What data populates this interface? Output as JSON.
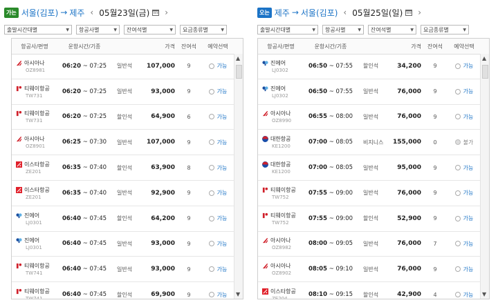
{
  "colors": {
    "accent": "#1b73c6",
    "badge_out": "#2a8a2a",
    "badge_in": "#1b73c6"
  },
  "outbound": {
    "badge": "가는",
    "from": "서울(김포)",
    "to": "제주",
    "date": "05월23일(금)",
    "filters": [
      "출발시간대별",
      "항공사별",
      "잔여석별",
      "요금종류별"
    ],
    "headers": {
      "airline": "항공사/편명",
      "time": "운항시간/기종",
      "price": "가격",
      "remaining": "잔여석",
      "reserve": "예약선택"
    },
    "flights": [
      {
        "airline": "아시아나",
        "code": "OZ8981",
        "logo": "asiana-logo-icon",
        "start": "06:20",
        "end": "07:25",
        "seat": "일반석",
        "price": "107,000",
        "remaining": "9",
        "label": "가능",
        "available": true
      },
      {
        "airline": "티웨이항공",
        "code": "TW731",
        "logo": "tway-logo-icon",
        "start": "06:20",
        "end": "07:25",
        "seat": "일반석",
        "price": "93,000",
        "remaining": "9",
        "label": "가능",
        "available": true
      },
      {
        "airline": "티웨이항공",
        "code": "TW731",
        "logo": "tway-logo-icon",
        "start": "06:20",
        "end": "07:25",
        "seat": "할인석",
        "price": "64,900",
        "remaining": "6",
        "label": "가능",
        "available": true
      },
      {
        "airline": "아시아나",
        "code": "OZ8901",
        "logo": "asiana-logo-icon",
        "start": "06:25",
        "end": "07:30",
        "seat": "일반석",
        "price": "107,000",
        "remaining": "9",
        "label": "가능",
        "available": true
      },
      {
        "airline": "이스타항공",
        "code": "ZE201",
        "logo": "eastar-logo-icon",
        "start": "06:35",
        "end": "07:40",
        "seat": "할인석",
        "price": "63,900",
        "remaining": "8",
        "label": "가능",
        "available": true
      },
      {
        "airline": "이스타항공",
        "code": "ZE201",
        "logo": "eastar-logo-icon",
        "start": "06:35",
        "end": "07:40",
        "seat": "일반석",
        "price": "92,900",
        "remaining": "9",
        "label": "가능",
        "available": true
      },
      {
        "airline": "진에어",
        "code": "LJ0301",
        "logo": "jinair-logo-icon",
        "start": "06:40",
        "end": "07:45",
        "seat": "할인석",
        "price": "64,200",
        "remaining": "9",
        "label": "가능",
        "available": true
      },
      {
        "airline": "진에어",
        "code": "LJ0301",
        "logo": "jinair-logo-icon",
        "start": "06:40",
        "end": "07:45",
        "seat": "일반석",
        "price": "93,000",
        "remaining": "9",
        "label": "가능",
        "available": true
      },
      {
        "airline": "티웨이항공",
        "code": "TW741",
        "logo": "tway-logo-icon",
        "start": "06:40",
        "end": "07:45",
        "seat": "일반석",
        "price": "93,000",
        "remaining": "9",
        "label": "가능",
        "available": true
      },
      {
        "airline": "티웨이항공",
        "code": "TW741",
        "logo": "tway-logo-icon",
        "start": "06:40",
        "end": "07:45",
        "seat": "할인석",
        "price": "69,900",
        "remaining": "9",
        "label": "가능",
        "available": true
      }
    ]
  },
  "inbound": {
    "badge": "오는",
    "from": "제주",
    "to": "서울(김포)",
    "date": "05월25일(일)",
    "filters": [
      "출발시간대별",
      "항공사별",
      "잔여석별",
      "요금종류별"
    ],
    "headers": {
      "airline": "항공사/편명",
      "time": "운항시간/기종",
      "price": "가격",
      "remaining": "잔여석",
      "reserve": "예약선택"
    },
    "flights": [
      {
        "airline": "진에어",
        "code": "LJ0302",
        "logo": "jinair-logo-icon",
        "start": "06:50",
        "end": "07:55",
        "seat": "할인석",
        "price": "34,200",
        "remaining": "9",
        "label": "가능",
        "available": true
      },
      {
        "airline": "진에어",
        "code": "LJ0302",
        "logo": "jinair-logo-icon",
        "start": "06:50",
        "end": "07:55",
        "seat": "일반석",
        "price": "76,000",
        "remaining": "9",
        "label": "가능",
        "available": true
      },
      {
        "airline": "아시아나",
        "code": "OZ8990",
        "logo": "asiana-logo-icon",
        "start": "06:55",
        "end": "08:00",
        "seat": "일반석",
        "price": "76,000",
        "remaining": "9",
        "label": "가능",
        "available": true
      },
      {
        "airline": "대한항공",
        "code": "KE1200",
        "logo": "koreanair-logo-icon",
        "start": "07:00",
        "end": "08:05",
        "seat": "비지니스",
        "price": "155,000",
        "remaining": "0",
        "label": "불가",
        "available": false
      },
      {
        "airline": "대한항공",
        "code": "KE1200",
        "logo": "koreanair-logo-icon",
        "start": "07:00",
        "end": "08:05",
        "seat": "일반석",
        "price": "95,000",
        "remaining": "9",
        "label": "가능",
        "available": true
      },
      {
        "airline": "티웨이항공",
        "code": "TW752",
        "logo": "tway-logo-icon",
        "start": "07:55",
        "end": "09:00",
        "seat": "일반석",
        "price": "76,000",
        "remaining": "9",
        "label": "가능",
        "available": true
      },
      {
        "airline": "티웨이항공",
        "code": "TW752",
        "logo": "tway-logo-icon",
        "start": "07:55",
        "end": "09:00",
        "seat": "할인석",
        "price": "52,900",
        "remaining": "9",
        "label": "가능",
        "available": true
      },
      {
        "airline": "아시아나",
        "code": "OZ8982",
        "logo": "asiana-logo-icon",
        "start": "08:00",
        "end": "09:05",
        "seat": "일반석",
        "price": "76,000",
        "remaining": "7",
        "label": "가능",
        "available": true
      },
      {
        "airline": "아시아나",
        "code": "OZ8902",
        "logo": "asiana-logo-icon",
        "start": "08:05",
        "end": "09:10",
        "seat": "일반석",
        "price": "76,000",
        "remaining": "9",
        "label": "가능",
        "available": true
      },
      {
        "airline": "이스타항공",
        "code": "ZE204",
        "logo": "eastar-logo-icon",
        "start": "08:10",
        "end": "09:15",
        "seat": "할인석",
        "price": "42,900",
        "remaining": "4",
        "label": "가능",
        "available": true
      }
    ]
  }
}
